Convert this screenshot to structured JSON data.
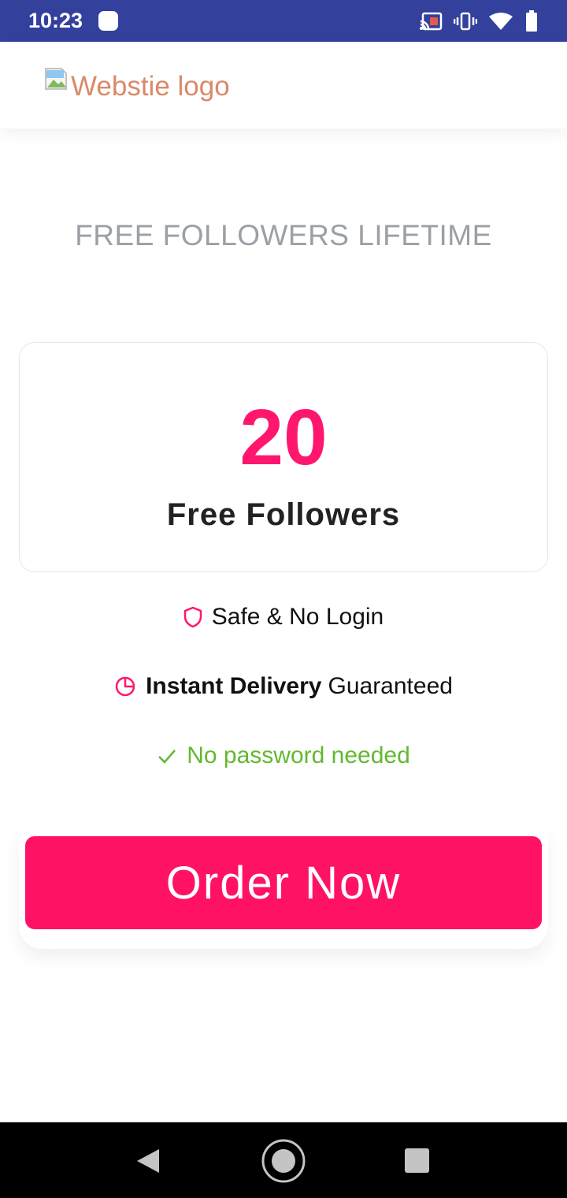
{
  "status_bar": {
    "time": "10:23",
    "icons": [
      "cast-icon",
      "vibrate-icon",
      "wifi-icon",
      "battery-icon"
    ]
  },
  "header": {
    "logo_alt": "Webstie logo"
  },
  "headline": "FREE FOLLOWERS LIFETIME",
  "offer": {
    "amount": "20",
    "label": "Free Followers"
  },
  "features": {
    "safe": "Safe & No Login",
    "instant_bold": "Instant Delivery",
    "instant_rest": "Guaranteed",
    "password": "No password needed"
  },
  "order_button": "Order Now",
  "colors": {
    "status_bar": "#33409c",
    "accent": "#ff166f",
    "success": "#63b830",
    "muted": "#9aa0a6",
    "logo_text": "#d98a68"
  }
}
